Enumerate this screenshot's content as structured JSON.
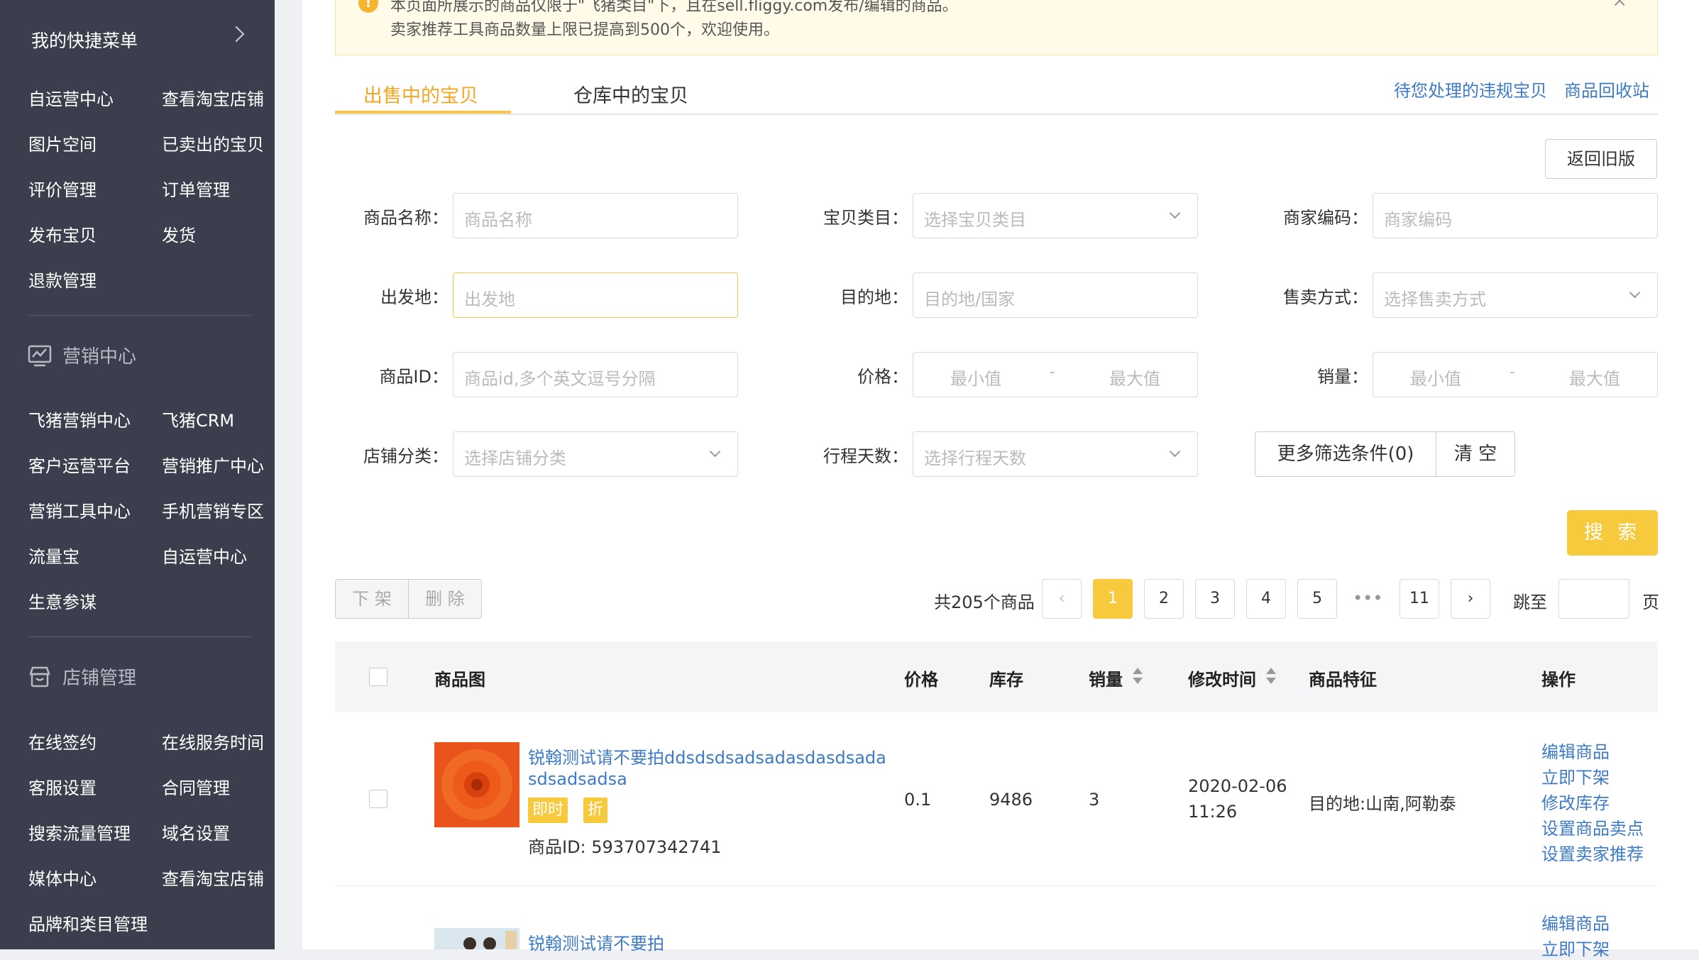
{
  "sidebar": {
    "quick_menu": "我的快捷菜单",
    "quick_items": [
      "自运营中心",
      "查看淘宝店铺",
      "图片空间",
      "已卖出的宝贝",
      "评价管理",
      "订单管理",
      "发布宝贝",
      "发货",
      "退款管理"
    ],
    "marketing_title": "营销中心",
    "marketing_items": [
      "飞猪营销中心",
      "飞猪CRM",
      "客户运营平台",
      "营销推广中心",
      "营销工具中心",
      "手机营销专区",
      "流量宝",
      "自运营中心",
      "生意参谋"
    ],
    "store_title": "店铺管理",
    "store_items": [
      "在线签约",
      "在线服务时间",
      "客服设置",
      "合同管理",
      "搜索流量管理",
      "域名设置",
      "媒体中心",
      "查看淘宝店铺",
      "品牌和类目管理"
    ]
  },
  "notice": {
    "line1": "本页面所展示的商品仅限于\"飞猪类目\"下，且在sell.fliggy.com发布/编辑的商品。",
    "line2": "卖家推荐工具商品数量上限已提高到500个，欢迎使用。"
  },
  "tabs": {
    "on_sale": "出售中的宝贝",
    "warehouse": "仓库中的宝贝",
    "violations": "待您处理的违规宝贝",
    "recycle": "商品回收站"
  },
  "filters": {
    "back_old": "返回旧版",
    "name_label": "商品名称：",
    "name_placeholder": "商品名称",
    "category_label": "宝贝类目：",
    "category_placeholder": "选择宝贝类目",
    "code_label": "商家编码：",
    "code_placeholder": "商家编码",
    "origin_label": "出发地：",
    "origin_placeholder": "出发地",
    "dest_label": "目的地：",
    "dest_placeholder": "目的地/国家",
    "sale_label": "售卖方式：",
    "sale_placeholder": "选择售卖方式",
    "id_label": "商品ID：",
    "id_placeholder": "商品id,多个英文逗号分隔",
    "price_label": "价格：",
    "sales_label": "销量：",
    "min": "最小值",
    "dash": "-",
    "max": "最大值",
    "shopcat_label": "店铺分类：",
    "shopcat_placeholder": "选择店铺分类",
    "days_label": "行程天数：",
    "days_placeholder": "选择行程天数",
    "more": "更多筛选条件(0)",
    "clear": "清 空",
    "search": "搜 索"
  },
  "actions": {
    "off_shelf": "下 架",
    "delete": "删 除"
  },
  "pagination": {
    "total": "共205个商品",
    "pages": [
      "1",
      "2",
      "3",
      "4",
      "5"
    ],
    "ellipsis": "•••",
    "last": "11",
    "prev": "‹",
    "next": "›",
    "jump": "跳至",
    "page_unit": "页"
  },
  "table": {
    "headers": [
      "商品图",
      "价格",
      "库存",
      "销量",
      "修改时间",
      "商品特征",
      "操作"
    ],
    "rows": [
      {
        "title_line1": "锐翰测试请不要拍ddsdsdsadsadasdasdsada",
        "title_line2": "sdsadsadsa",
        "tag1": "即时",
        "tag2": "折",
        "id": "商品ID: 593707342741",
        "price": "0.1",
        "stock": "9486",
        "sales": "3",
        "date": "2020-02-06",
        "time": "11:26",
        "feature": "目的地:山南,阿勒泰",
        "ops": [
          "编辑商品",
          "立即下架",
          "修改库存",
          "设置商品卖点",
          "设置卖家推荐"
        ]
      },
      {
        "title_line1": "锐翰测试请不要拍",
        "ops": [
          "编辑商品",
          "立即下架"
        ]
      }
    ]
  },
  "colors": {
    "accent": "#f7c93c",
    "link": "#3d7bc6",
    "sidebar": "#3b3f4d"
  }
}
